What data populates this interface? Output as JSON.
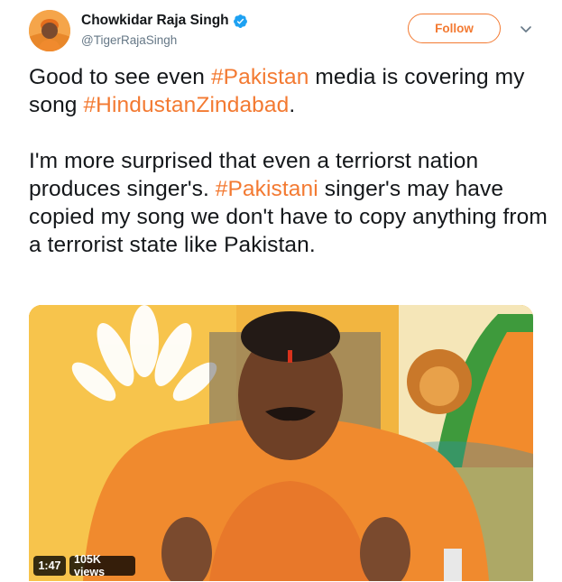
{
  "user": {
    "display_name": "Chowkidar Raja Singh",
    "handle": "@TigerRajaSingh",
    "verified": true
  },
  "actions": {
    "follow_label": "Follow"
  },
  "icons": {
    "verified": "verified-badge-icon",
    "caret": "chevron-down-icon"
  },
  "tweet": {
    "p1_t1": "Good to see even ",
    "p1_h1": "#Pakistan",
    "p1_t2": " media is covering my song ",
    "p1_h2": "#HindustanZindabad",
    "p1_t3": ".",
    "p2_t1": "I'm more surprised that even a terriorst nation produces singer's. ",
    "p2_h1": "#Pakistani",
    "p2_t2": " singer's may have copied my song we don't have to copy anything from a terrorist state like Pakistan."
  },
  "media": {
    "duration": "1:47",
    "views": "105K views"
  },
  "colors": {
    "accent": "#f37a32",
    "text": "#14171a",
    "muted": "#657786",
    "verified": "#1da1f2"
  }
}
